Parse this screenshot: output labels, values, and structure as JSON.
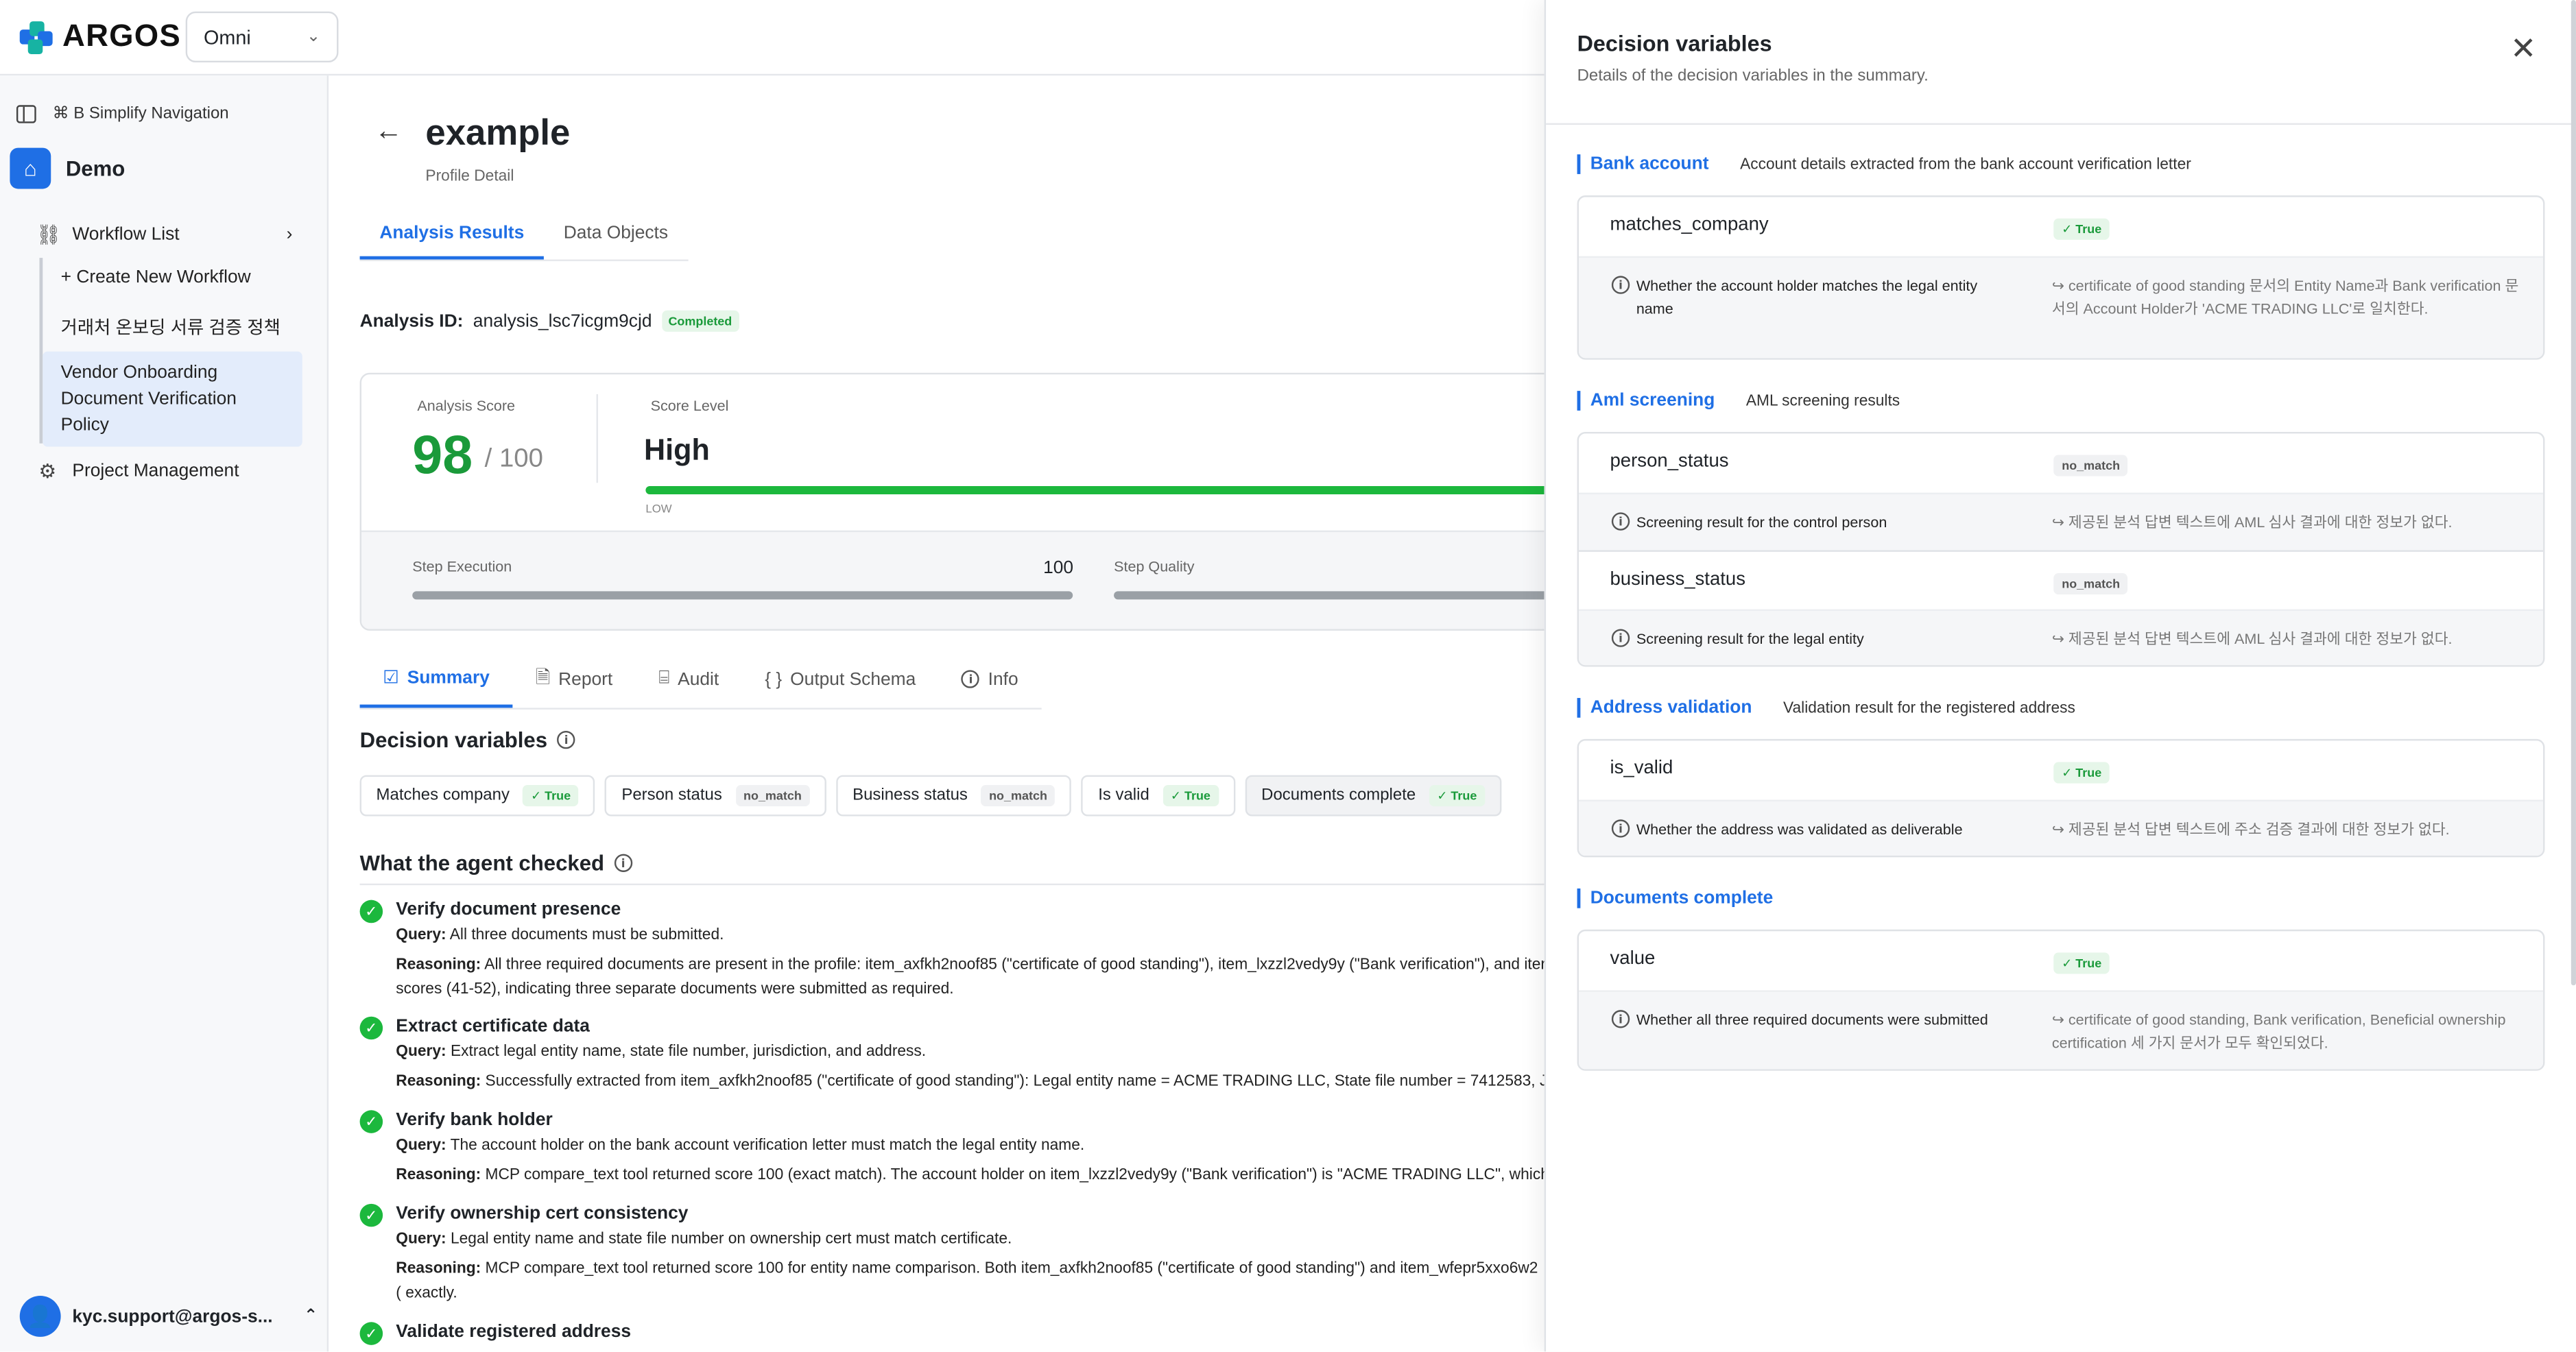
{
  "app": {
    "logo": "ARGOS",
    "environment": "Omni"
  },
  "sidebar": {
    "toggle_label": "⌘ B Simplify Navigation",
    "workspace": "Demo",
    "workflow_list": "Workflow List",
    "items": [
      "+ Create New Workflow",
      "거래처 온보딩 서류 검증 정책",
      "Vendor Onboarding Document Verification Policy"
    ],
    "project_management": "Project Management",
    "user_email": "kyc.support@argos-s..."
  },
  "page": {
    "title": "example",
    "subtitle": "Profile Detail",
    "tabs": [
      "Analysis Results",
      "Data Objects"
    ],
    "analysis_id_label": "Analysis ID:",
    "analysis_id": "analysis_lsc7icgm9cjd",
    "status": "Completed",
    "score": {
      "label": "Analysis Score",
      "value": "98",
      "max": "/ 100",
      "level_label": "Score Level",
      "level": "High",
      "level_low": "LOW",
      "step_execution_label": "Step Execution",
      "step_execution_value": "100",
      "step_quality_label": "Step Quality"
    },
    "subtabs": [
      "Summary",
      "Report",
      "Audit",
      "Output Schema",
      "Info"
    ],
    "decision_variables_title": "Decision variables",
    "chips": [
      {
        "label": "Matches company",
        "value": "True"
      },
      {
        "label": "Person status",
        "value": "no_match"
      },
      {
        "label": "Business status",
        "value": "no_match"
      },
      {
        "label": "Is valid",
        "value": "True"
      },
      {
        "label": "Documents complete",
        "value": "True"
      }
    ],
    "checks_title": "What the agent checked",
    "query_label": "Query:",
    "reasoning_label": "Reasoning:",
    "checks": [
      {
        "title": "Verify document presence",
        "query": "All three documents must be submitted.",
        "reasoning": "All three required documents are present in the profile: item_axfkh2noof85 (\"certificate of good standing\"), item_lxzzl2vedy9y (\"Bank verification\"), and iter scores (41-52), indicating three separate documents were submitted as required."
      },
      {
        "title": "Extract certificate data",
        "query": "Extract legal entity name, state file number, jurisdiction, and address.",
        "reasoning": "Successfully extracted from item_axfkh2noof85 (\"certificate of good standing\"): Legal entity name = ACME TRADING LLC, State file number = 7412583, Ju"
      },
      {
        "title": "Verify bank holder",
        "query": "The account holder on the bank account verification letter must match the legal entity name.",
        "reasoning": "MCP compare_text tool returned score 100 (exact match). The account holder on item_lxzzl2vedy9y (\"Bank verification\") is \"ACME TRADING LLC\", which m"
      },
      {
        "title": "Verify ownership cert consistency",
        "query": "Legal entity name and state file number on ownership cert must match certificate.",
        "reasoning": "MCP compare_text tool returned score 100 for entity name comparison. Both item_axfkh2noof85 (\"certificate of good standing\") and item_wfepr5xxo6w2 ( exactly."
      },
      {
        "title": "Validate registered address",
        "query": "",
        "reasoning": ""
      }
    ]
  },
  "panel": {
    "title": "Decision variables",
    "subtitle": "Details of the decision variables in the summary.",
    "groups": [
      {
        "name": "Bank account",
        "desc": "Account details extracted from the bank account verification letter",
        "vars": [
          {
            "name": "matches_company",
            "value": "True",
            "description": "Whether the account holder matches the legal entity name",
            "reason": "↪ certificate of good standing 문서의 Entity Name과 Bank verification 문서의 Account Holder가 'ACME TRADING LLC'로 일치한다."
          }
        ]
      },
      {
        "name": "Aml screening",
        "desc": "AML screening results",
        "vars": [
          {
            "name": "person_status",
            "value": "no_match",
            "description": "Screening result for the control person",
            "reason": "↪ 제공된 분석 답변 텍스트에 AML 심사 결과에 대한 정보가 없다."
          },
          {
            "name": "business_status",
            "value": "no_match",
            "description": "Screening result for the legal entity",
            "reason": "↪ 제공된 분석 답변 텍스트에 AML 심사 결과에 대한 정보가 없다."
          }
        ]
      },
      {
        "name": "Address validation",
        "desc": "Validation result for the registered address",
        "vars": [
          {
            "name": "is_valid",
            "value": "True",
            "description": "Whether the address was validated as deliverable",
            "reason": "↪ 제공된 분석 답변 텍스트에 주소 검증 결과에 대한 정보가 없다."
          }
        ]
      },
      {
        "name": "Documents complete",
        "desc": "",
        "vars": [
          {
            "name": "value",
            "value": "True",
            "description": "Whether all three required documents were submitted",
            "reason": "↪ certificate of good standing, Bank verification, Beneficial ownership certification 세 가지 문서가 모두 확인되었다."
          }
        ]
      }
    ]
  },
  "colors": {
    "accent": "#1f6fe5",
    "success": "#1cb83d",
    "score": "#1a9a3a"
  }
}
